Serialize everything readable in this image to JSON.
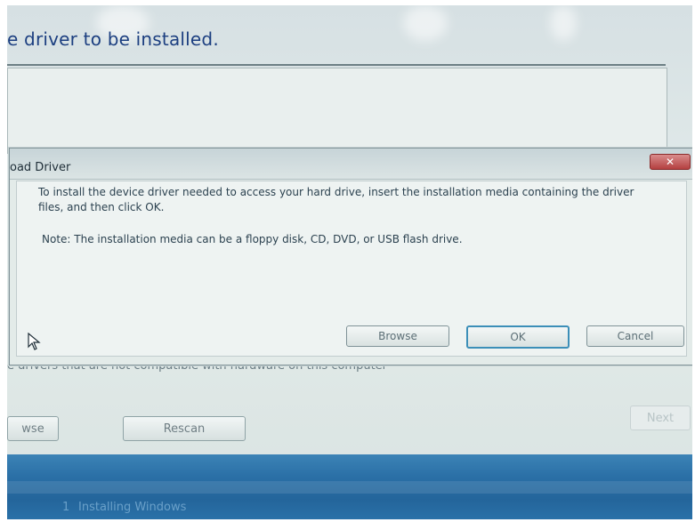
{
  "wizard": {
    "heading": "e driver to be installed.",
    "hidden_drivers_text": "e drivers that are not compatible with hardware on this computer",
    "buttons": {
      "browse": "wse",
      "rescan": "Rescan",
      "next": "Next"
    }
  },
  "dialog": {
    "title": "oad Driver",
    "close_label": "✕",
    "message": "To install the device driver needed to access your hard drive, insert the installation media containing the driver files, and then click OK.",
    "note": "Note: The installation media can be a floppy disk, CD, DVD, or USB flash drive.",
    "buttons": {
      "browse": "Browse",
      "ok": "OK",
      "cancel": "Cancel"
    }
  },
  "taskbar": {
    "step_number": "1",
    "status": "Installing Windows"
  },
  "colors": {
    "heading": "#1c3f80",
    "taskbar": "#2a6fa6",
    "close": "#b44040",
    "default_button_border": "#3c8fb8"
  },
  "icons": {
    "cursor": "mouse-pointer-icon",
    "close": "close-icon"
  }
}
